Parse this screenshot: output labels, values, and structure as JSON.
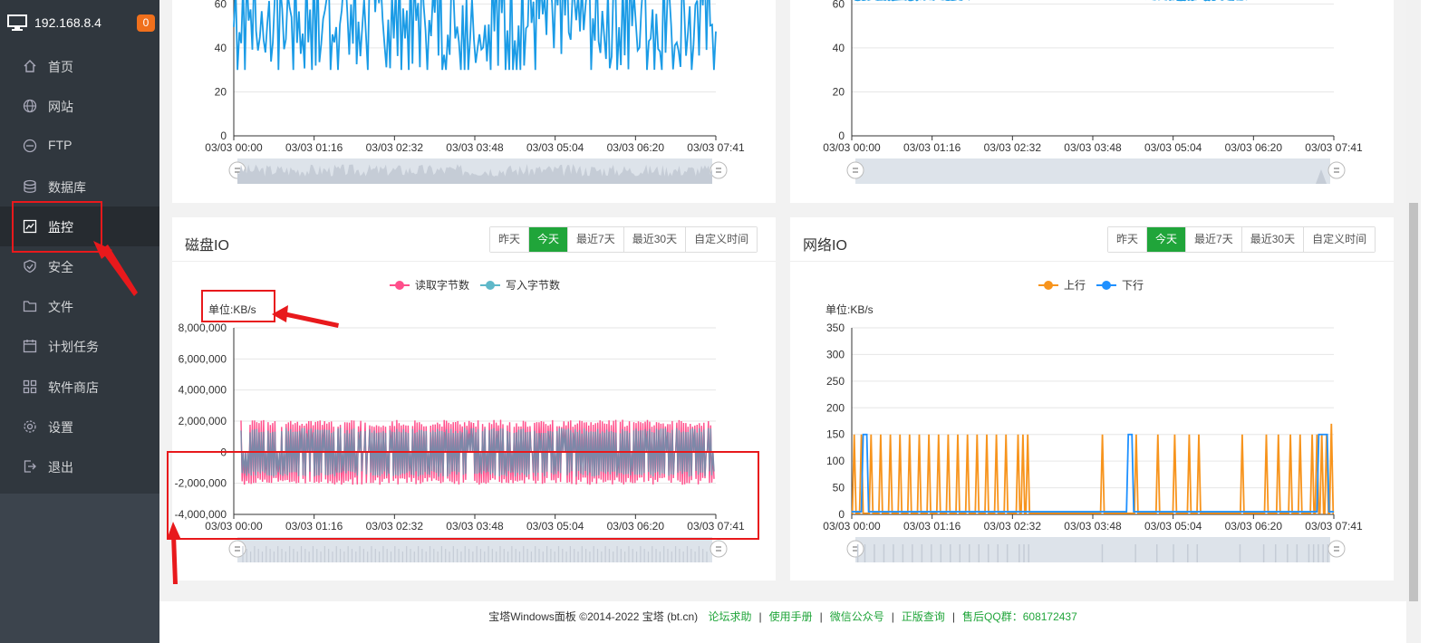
{
  "sidebar": {
    "server_ip": "192.168.8.4",
    "badge_count": "0",
    "items": [
      {
        "label": "首页",
        "icon": "home-icon"
      },
      {
        "label": "网站",
        "icon": "globe-icon"
      },
      {
        "label": "FTP",
        "icon": "ftp-icon"
      },
      {
        "label": "数据库",
        "icon": "database-icon"
      },
      {
        "label": "监控",
        "icon": "monitor-chart-icon"
      },
      {
        "label": "安全",
        "icon": "shield-icon"
      },
      {
        "label": "文件",
        "icon": "folder-icon"
      },
      {
        "label": "计划任务",
        "icon": "calendar-icon"
      },
      {
        "label": "软件商店",
        "icon": "apps-grid-icon"
      },
      {
        "label": "设置",
        "icon": "gear-icon"
      },
      {
        "label": "退出",
        "icon": "logout-icon"
      }
    ],
    "active_item": "监控"
  },
  "range_tabs": [
    "昨天",
    "今天",
    "最近7天",
    "最近30天",
    "自定义时间"
  ],
  "active_tab": "今天",
  "disk_io": {
    "title": "磁盘IO",
    "unit": "单位:KB/s",
    "legend": [
      "读取字节数",
      "写入字节数"
    ]
  },
  "network_io": {
    "title": "网络IO",
    "unit": "单位:KB/s",
    "legend": [
      "上行",
      "下行"
    ]
  },
  "footer": {
    "copyright": "宝塔Windows面板 ©2014-2022 宝塔 (bt.cn)",
    "links": [
      "论坛求助",
      "使用手册",
      "微信公众号",
      "正版查询"
    ],
    "qq": "售后QQ群：608172437"
  },
  "colors": {
    "accent_green": "#20a53a",
    "read_series": "#ff4f8b",
    "write_series": "#5fb8c9",
    "up_series": "#f7941d",
    "down_series": "#1e90ff",
    "cpu_line": "#1a9be6",
    "annotation_red": "#e8191c"
  },
  "chart_data": [
    {
      "type": "line",
      "title": "",
      "x": [
        "03/03 00:00",
        "03/03 01:16",
        "03/03 02:32",
        "03/03 03:48",
        "03/03 05:04",
        "03/03 06:20",
        "03/03 07:41"
      ],
      "ylim": [
        0,
        75
      ],
      "yticks": [
        "0",
        "20",
        "40",
        "60"
      ],
      "series": [
        {
          "values": [
            50,
            65,
            40,
            60,
            45,
            70,
            35,
            55,
            48,
            62
          ]
        }
      ],
      "grid": true
    },
    {
      "type": "line",
      "title": "",
      "x": [
        "03/03 00:00",
        "03/03 01:16",
        "03/03 02:32",
        "03/03 03:48",
        "03/03 05:04",
        "03/03 06:20",
        "03/03 07:41"
      ],
      "ylim": [
        0,
        75
      ],
      "yticks": [
        "0",
        "20",
        "40",
        "60"
      ],
      "series": [
        {
          "values": [
            62,
            62,
            62,
            64,
            63,
            63,
            62,
            62,
            63,
            70
          ]
        }
      ],
      "grid": true
    },
    {
      "type": "line",
      "title": "磁盘IO",
      "ylabel": "单位:KB/s",
      "x": [
        "03/03 00:00",
        "03/03 01:16",
        "03/03 02:32",
        "03/03 03:48",
        "03/03 05:04",
        "03/03 06:20",
        "03/03 07:41"
      ],
      "ylim": [
        -4000000,
        8000000
      ],
      "yticks": [
        "-4,000,000",
        "-2,000,000",
        "0",
        "2,000,000",
        "4,000,000",
        "6,000,000",
        "8,000,000"
      ],
      "series": [
        {
          "name": "读取字节数",
          "values": [
            1900000,
            -2000000,
            2100000,
            -2100000,
            2100000,
            -2000000
          ]
        },
        {
          "name": "写入字节数",
          "values": [
            1500000,
            -1500000,
            1500000,
            -1500000,
            1500000,
            -1500000
          ]
        }
      ],
      "legend": "top-center",
      "grid": true
    },
    {
      "type": "line",
      "title": "网络IO",
      "ylabel": "单位:KB/s",
      "x": [
        "03/03 00:00",
        "03/03 01:16",
        "03/03 02:32",
        "03/03 03:48",
        "03/03 05:04",
        "03/03 06:20",
        "03/03 07:41"
      ],
      "ylim": [
        0,
        350
      ],
      "yticks": [
        "0",
        "50",
        "100",
        "150",
        "200",
        "250",
        "300",
        "350"
      ],
      "series": [
        {
          "name": "上行",
          "values": [
            150,
            0,
            150,
            0,
            150,
            0,
            150,
            0,
            170
          ]
        },
        {
          "name": "下行",
          "values": [
            5,
            150,
            5,
            5,
            5,
            150,
            5,
            5,
            150
          ]
        }
      ],
      "legend": "top-center",
      "grid": true
    }
  ]
}
